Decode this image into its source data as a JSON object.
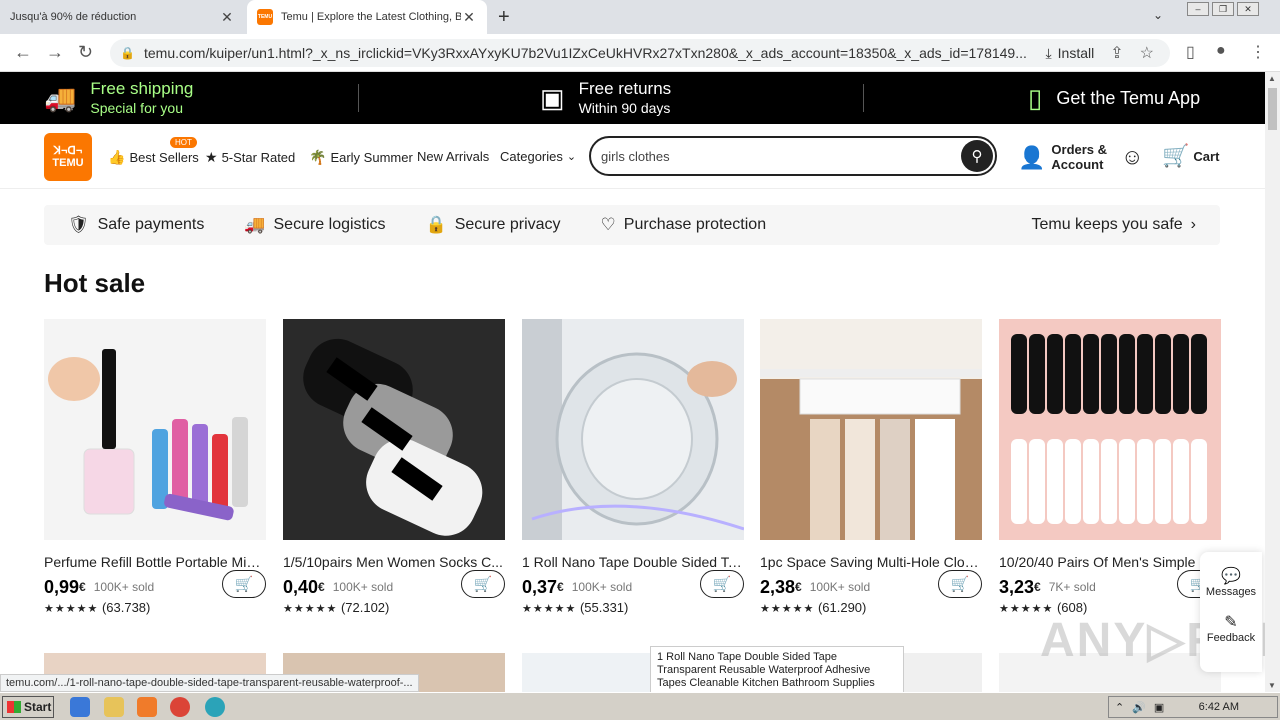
{
  "browser": {
    "tabs": [
      {
        "title": "Jusqu'à 90% de réduction",
        "active": false
      },
      {
        "title": "Temu | Explore the Latest Clothing, B",
        "active": true
      }
    ],
    "url": "temu.com/kuiper/un1.html?_x_ns_irclickid=VKy3RxxAYxyKU7b2Vu1IZxCeUkHVRx27xTxn280&_x_ads_account=18350&_x_ads_id=178149...",
    "install_label": "Install"
  },
  "promo": {
    "shipping_l1": "Free shipping",
    "shipping_l2": "Special for you",
    "returns_l1": "Free returns",
    "returns_l2": "Within 90 days",
    "app": "Get the Temu App"
  },
  "header": {
    "logo_line1": "ꓘ¬ꓷ¬",
    "logo_line2": "TEMU",
    "nav": [
      {
        "label": "Best Sellers",
        "icon": "thumbs-up-icon"
      },
      {
        "label": "5-Star Rated",
        "icon": "star-badge-icon"
      },
      {
        "label": "Early Summer",
        "icon": "palm-tree-icon"
      },
      {
        "label": "New Arrivals",
        "icon": ""
      },
      {
        "label": "Categories",
        "icon": "chevron-down-icon"
      }
    ],
    "hot_badge": "HOT",
    "search_value": "girls clothes",
    "orders_l1": "Orders &",
    "orders_l2": "Account",
    "cart_label": "Cart"
  },
  "safety": {
    "items": [
      "Safe payments",
      "Secure logistics",
      "Secure privacy",
      "Purchase protection"
    ],
    "keep_safe": "Temu keeps you safe"
  },
  "hot_sale_title": "Hot sale",
  "products": [
    {
      "name": "Perfume Refill Bottle Portable Mini ...",
      "price": "0,99",
      "currency": "€",
      "sold": "100K+ sold",
      "rating": 4.5,
      "reviews": "(63.738)"
    },
    {
      "name": "1/5/10pairs Men Women Socks C...",
      "price": "0,40",
      "currency": "€",
      "sold": "100K+ sold",
      "rating": 4.5,
      "reviews": "(72.102)"
    },
    {
      "name": "1 Roll Nano Tape Double Sided Ta...",
      "price": "0,37",
      "currency": "€",
      "sold": "100K+ sold",
      "rating": 5,
      "reviews": "(55.331)"
    },
    {
      "name": "1pc Space Saving Multi-Hole Cloth...",
      "price": "2,38",
      "currency": "€",
      "sold": "100K+ sold",
      "rating": 4.5,
      "reviews": "(61.290)"
    },
    {
      "name": "10/20/40 Pairs Of Men's Simple S",
      "price": "3,23",
      "currency": "€",
      "sold": "7K+ sold",
      "rating": 4.5,
      "reviews": "(608)"
    }
  ],
  "tooltip": "1 Roll Nano Tape Double Sided Tape Transparent Reusable Waterproof Adhesive Tapes Cleanable Kitchen Bathroom Supplies",
  "status_url": "temu.com/.../1-roll-nano-tape-double-sided-tape-transparent-reusable-waterproof-...",
  "side": {
    "messages": "Messages",
    "feedback": "Feedback"
  },
  "taskbar": {
    "start": "Start",
    "time": "6:42 AM"
  },
  "colors": {
    "brand": "#fb7701",
    "promo_bg": "#000000",
    "promo_accent": "#a9ff87"
  }
}
